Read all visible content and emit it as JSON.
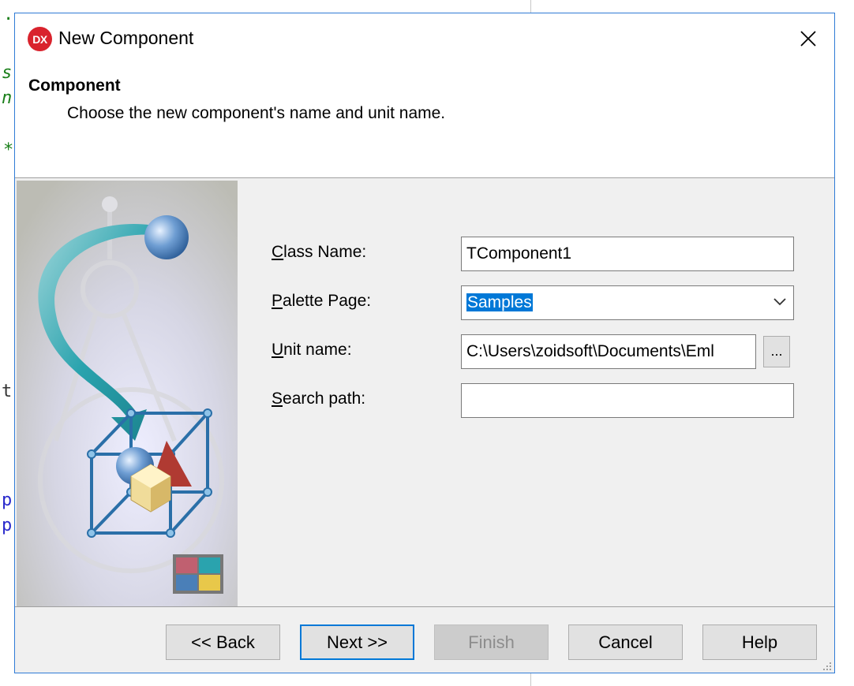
{
  "window": {
    "title": "New Component",
    "logo_text": "DX",
    "close_glyph": "✕"
  },
  "header": {
    "title": "Component",
    "subtitle": "Choose the new component's name and unit name."
  },
  "form": {
    "class_name": {
      "label_mnemonic": "C",
      "label_rest": "lass Name:",
      "value": "TComponent1"
    },
    "palette_page": {
      "label_mnemonic": "P",
      "label_rest": "alette Page:",
      "value": "Samples"
    },
    "unit_name": {
      "label_mnemonic": "U",
      "label_rest": "nit name:",
      "value": "C:\\Users\\zoidsoft\\Documents\\Eml",
      "browse_label": "..."
    },
    "search_path": {
      "label_mnemonic": "S",
      "label_rest": "earch path:",
      "value": ""
    }
  },
  "buttons": {
    "back": "<< Back",
    "next": "Next >>",
    "finish": "Finish",
    "cancel": "Cancel",
    "help": "Help"
  },
  "background_editor": {
    "fragments": [
      ".",
      "s",
      "n",
      "*",
      "t",
      "p",
      "p"
    ]
  },
  "colors": {
    "accent": "#0078d7",
    "logo": "#d9232d",
    "dialog_border": "#2f7bd6"
  }
}
